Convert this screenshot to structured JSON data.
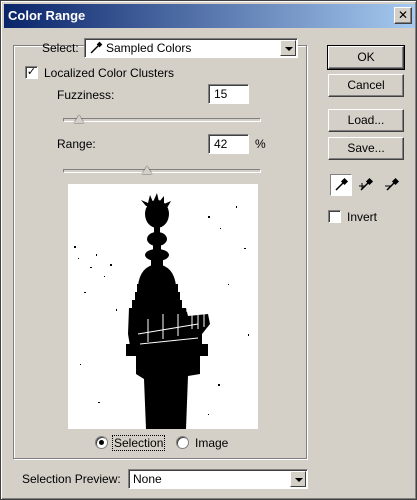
{
  "dialog": {
    "title": "Color Range",
    "close_glyph": "✕"
  },
  "select": {
    "label": "Select:",
    "value": "Sampled Colors",
    "icon": "eyedropper-icon"
  },
  "localized": {
    "label": "Localized Color Clusters",
    "checked": true,
    "check_glyph": "✓"
  },
  "fuzziness": {
    "label": "Fuzziness:",
    "value": "15",
    "max": 200
  },
  "range": {
    "label": "Range:",
    "value": "42",
    "unit": "%",
    "max": 100
  },
  "preview_mode": {
    "selection_label": "Selection",
    "image_label": "Image",
    "selected": "selection"
  },
  "selection_preview": {
    "label": "Selection Preview:",
    "value": "None"
  },
  "buttons": {
    "ok": "OK",
    "cancel": "Cancel",
    "load": "Load...",
    "save": "Save..."
  },
  "tools": {
    "eyedropper": "eyedropper-icon",
    "add": "eyedropper-plus-icon",
    "subtract": "eyedropper-minus-icon",
    "active": "eyedropper"
  },
  "invert": {
    "label": "Invert",
    "checked": false
  }
}
